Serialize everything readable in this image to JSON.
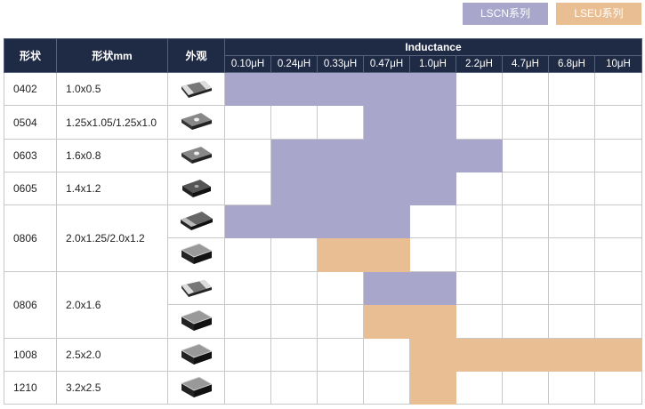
{
  "legend": {
    "lscn": "LSCN系列",
    "lseu": "LSEU系列"
  },
  "header": {
    "shape": "形状",
    "size": "形状mm",
    "appearance": "外观",
    "inductance": "Inductance",
    "values": [
      "0.10μH",
      "0.24μH",
      "0.33μH",
      "0.47μH",
      "1.0μH",
      "2.2μH",
      "4.7μH",
      "6.8μH",
      "10μH"
    ]
  },
  "rows": [
    {
      "code": "0402",
      "size": "1.0x0.5",
      "chip": "small",
      "fill": [
        "A",
        "A",
        "A",
        "A",
        "A",
        "",
        "",
        "",
        ""
      ]
    },
    {
      "code": "0504",
      "size": "1.25x1.05/1.25x1.0",
      "chip": "dot",
      "fill": [
        "",
        "",
        "",
        "A",
        "A",
        "",
        "",
        "",
        ""
      ]
    },
    {
      "code": "0603",
      "size": "1.6x0.8",
      "chip": "dot",
      "fill": [
        "",
        "A",
        "A",
        "A",
        "A",
        "A",
        "",
        "",
        ""
      ]
    },
    {
      "code": "0605",
      "size": "1.4x1.2",
      "chip": "dark",
      "fill": [
        "",
        "A",
        "A",
        "A",
        "A",
        "",
        "",
        "",
        ""
      ]
    },
    {
      "code": "0806",
      "size": "2.0x1.25/2.0x1.2",
      "chip": "wide",
      "fill": [
        "A",
        "A",
        "A",
        "A",
        "",
        "",
        "",
        "",
        ""
      ]
    },
    {
      "code": "",
      "size": "",
      "chip": "box",
      "fill": [
        "",
        "",
        "E",
        "E",
        "",
        "",
        "",
        "",
        ""
      ]
    },
    {
      "code": "0806",
      "size": "2.0x1.6",
      "chip": "small",
      "fill": [
        "",
        "",
        "",
        "A",
        "A",
        "",
        "",
        "",
        ""
      ]
    },
    {
      "code": "",
      "size": "",
      "chip": "box",
      "fill": [
        "",
        "",
        "",
        "E",
        "E",
        "",
        "",
        "",
        ""
      ]
    },
    {
      "code": "1008",
      "size": "2.5x2.0",
      "chip": "box",
      "fill": [
        "",
        "",
        "",
        "",
        "E",
        "E",
        "E",
        "E",
        "E"
      ]
    },
    {
      "code": "1210",
      "size": "3.2x2.5",
      "chip": "box",
      "fill": [
        "",
        "",
        "",
        "",
        "E",
        "",
        "",
        "",
        ""
      ]
    }
  ],
  "colors": {
    "lscn": "#a8a6ca",
    "lseu": "#e9be93",
    "header": "#1f2a44"
  }
}
